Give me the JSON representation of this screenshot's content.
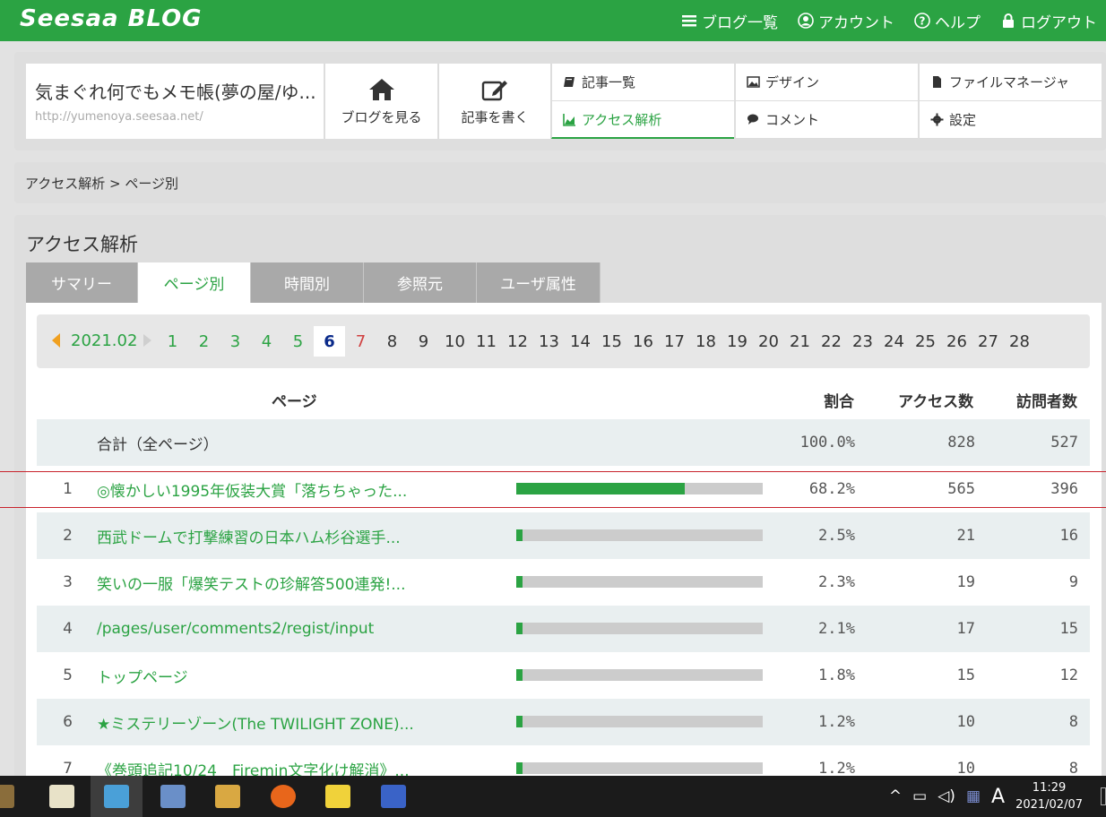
{
  "topbar": {
    "logo": "Seesaa BLOG",
    "nav": [
      {
        "label": "ブログ一覧",
        "icon": "list-icon"
      },
      {
        "label": "アカウント",
        "icon": "account-icon"
      },
      {
        "label": "ヘルプ",
        "icon": "help-icon"
      },
      {
        "label": "ログアウト",
        "icon": "lock-icon"
      }
    ]
  },
  "blog": {
    "title": "気まぐれ何でもメモ帳(夢の屋/ゆ...",
    "url": "http://yumenoya.seesaa.net/"
  },
  "actions": {
    "view_blog": "ブログを見る",
    "write_post": "記事を書く"
  },
  "menu": {
    "posts": "記事一覧",
    "design": "デザイン",
    "file_manager": "ファイルマネージャ",
    "analytics": "アクセス解析",
    "comments": "コメント",
    "settings": "設定"
  },
  "breadcrumb": "アクセス解析 > ページ別",
  "section_title": "アクセス解析",
  "tabs": [
    {
      "label": "サマリー"
    },
    {
      "label": "ページ別"
    },
    {
      "label": "時間別"
    },
    {
      "label": "参照元"
    },
    {
      "label": "ユーザ属性"
    }
  ],
  "month": "2021.02",
  "days": [
    "1",
    "2",
    "3",
    "4",
    "5",
    "6",
    "7",
    "8",
    "9",
    "10",
    "11",
    "12",
    "13",
    "14",
    "15",
    "16",
    "17",
    "18",
    "19",
    "20",
    "21",
    "22",
    "23",
    "24",
    "25",
    "26",
    "27",
    "28"
  ],
  "table": {
    "headers": {
      "page": "ページ",
      "ratio": "割合",
      "access": "アクセス数",
      "visitors": "訪問者数"
    },
    "total": {
      "label": "合計（全ページ）",
      "ratio": "100.0%",
      "access": "828",
      "visitors": "527"
    },
    "rows": [
      {
        "rank": "1",
        "page": "◎懐かしい1995年仮装大賞「落ちちゃった...",
        "ratio": "68.2%",
        "access": "565",
        "visitors": "396",
        "share": 0.682
      },
      {
        "rank": "2",
        "page": "西武ドームで打撃練習の日本ハム杉谷選手...",
        "ratio": "2.5%",
        "access": "21",
        "visitors": "16",
        "share": 0.025
      },
      {
        "rank": "3",
        "page": "笑いの一服「爆笑テストの珍解答500連発!...",
        "ratio": "2.3%",
        "access": "19",
        "visitors": "9",
        "share": 0.023
      },
      {
        "rank": "4",
        "page": "/pages/user/comments2/regist/input",
        "ratio": "2.1%",
        "access": "17",
        "visitors": "15",
        "share": 0.021
      },
      {
        "rank": "5",
        "page": "トップページ",
        "ratio": "1.8%",
        "access": "15",
        "visitors": "12",
        "share": 0.018
      },
      {
        "rank": "6",
        "page": "★ミステリーゾーン(The TWILIGHT ZONE)...",
        "ratio": "1.2%",
        "access": "10",
        "visitors": "8",
        "share": 0.012
      },
      {
        "rank": "7",
        "page": "《巻頭追記10/24　Firemin文字化け解消》...",
        "ratio": "1.2%",
        "access": "10",
        "visitors": "8",
        "share": 0.012
      }
    ]
  },
  "taskbar": {
    "ime": "A",
    "time": "11:29",
    "date": "2021/02/07"
  }
}
